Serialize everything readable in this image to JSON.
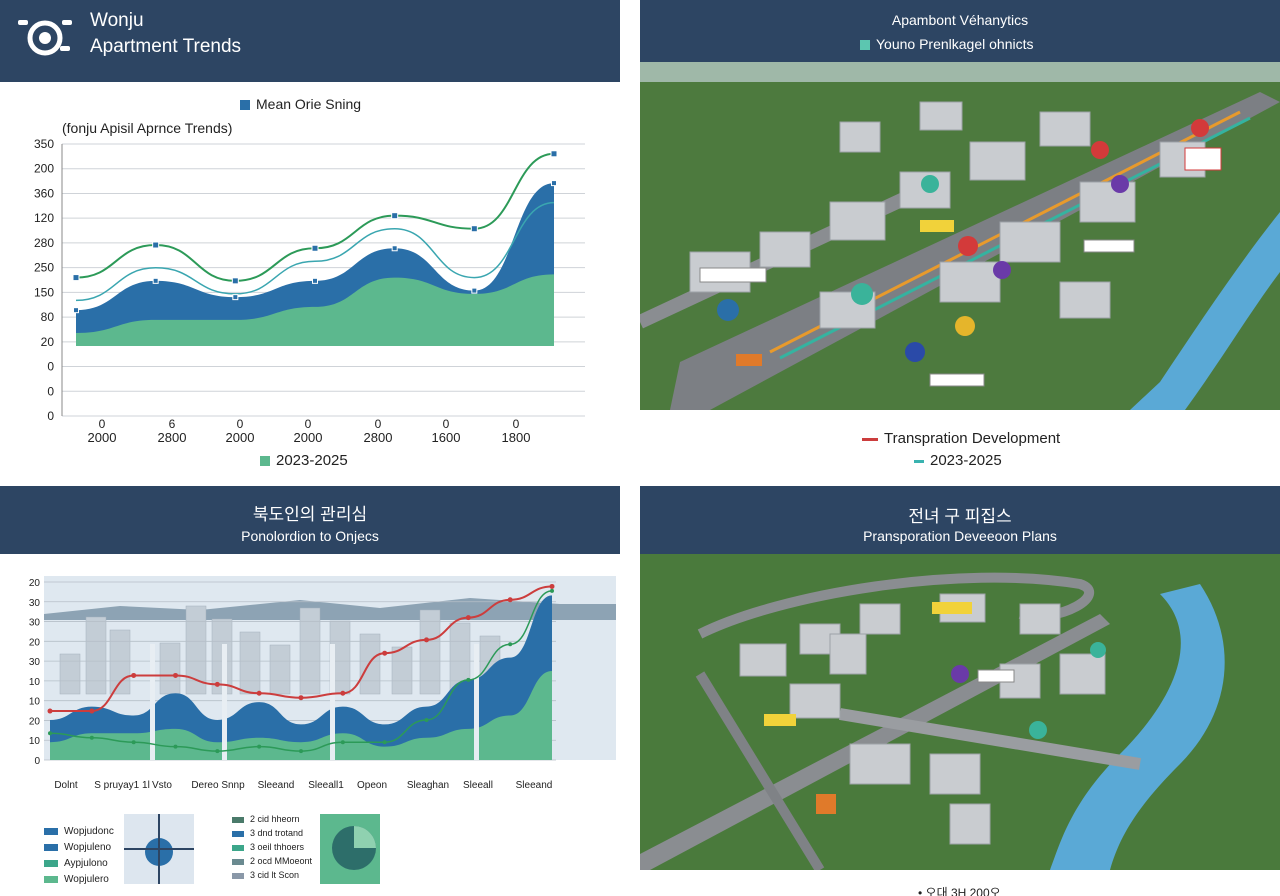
{
  "tl": {
    "title_line1": "Wonju",
    "title_line2": "Apartment Trends",
    "legend": "Mean Orie Sning",
    "subtitle": "(fonju Apisil Aprnce Trends)",
    "footer_legend": "2023-2025"
  },
  "tr": {
    "title": "Apambont Véhanytics",
    "legend": "Youno Prenlkagel ohnicts",
    "map_labels": [
      "Transpration Development",
      "2023-2025"
    ]
  },
  "bl": {
    "title_korean": "북도인의 관리심",
    "subtitle": "Ponolordion to Onjecs",
    "legend_a": [
      "Wopjudonc",
      "Wopjuleno",
      "Aypjulono",
      "Wopjulero"
    ],
    "legend_b": [
      "2 cid hheorn",
      "3 dnd trotand",
      "3 oeil thhoers",
      "2 ocd MMoeont",
      "3 cid lt Scon"
    ]
  },
  "br": {
    "title_korean": "전녀 구 피집스",
    "subtitle": "Pransporation Deveeoon Plans",
    "footer": "• 오대 3H 200오"
  },
  "colors": {
    "header": "#2d4563",
    "blue": "#2a6fa8",
    "teal": "#5cb88e",
    "green_line": "#2c9a58",
    "red_line": "#cc3d3d",
    "river": "#5aa9d6"
  },
  "chart_data": [
    {
      "type": "area",
      "title": "(fonju Apisil Aprnce Trends)",
      "legend": [
        "Mean Orie Sning",
        "2023-2025"
      ],
      "y_tick_labels": [
        "350",
        "200",
        "360",
        "120",
        "280",
        "250",
        "150",
        "80",
        "20",
        "0",
        "0",
        "0"
      ],
      "x_tick_labels_top": [
        "0",
        "6",
        "0",
        "0",
        "0",
        "0",
        "0"
      ],
      "x_tick_labels": [
        "2000",
        "2800",
        "2000",
        "2000",
        "2800",
        "1600",
        "1800"
      ],
      "series": [
        {
          "name": "Mean Orie Sning",
          "values": [
            1.1,
            2.0,
            1.5,
            2.0,
            3.0,
            1.7,
            5.0
          ]
        },
        {
          "name": "2023-2025",
          "values": [
            0.4,
            0.8,
            0.8,
            1.2,
            2.1,
            1.6,
            2.2
          ]
        },
        {
          "values": [
            2.1,
            3.1,
            2.0,
            3.0,
            4.0,
            3.6,
            5.9
          ]
        },
        {
          "values": [
            1.4,
            2.4,
            1.6,
            2.6,
            3.6,
            2.1,
            4.4
          ]
        }
      ]
    },
    {
      "type": "area",
      "y_tick_labels": [
        "20",
        "30",
        "30",
        "20",
        "30",
        "10",
        "10",
        "20",
        "10",
        "0"
      ],
      "x_tick_labels": [
        "Dolnt",
        "S pruyay1 1l",
        "Vsto",
        "Dereo Snnp",
        "Sleeand",
        "Sleeall1",
        "Opeon",
        "Sleaghan",
        "Sleeall",
        "Sleeand"
      ],
      "series": [
        {
          "values": [
            0.45,
            0.6,
            0.5,
            0.75,
            0.45,
            0.65,
            0.4,
            0.6,
            0.4,
            0.6,
            0.9,
            1.15,
            1.85
          ]
        },
        {
          "values": [
            0.2,
            0.3,
            0.3,
            0.35,
            0.2,
            0.25,
            0.2,
            0.3,
            0.15,
            0.25,
            0.35,
            0.5,
            1.0
          ]
        },
        {
          "values": [
            0.55,
            0.55,
            0.95,
            0.95,
            0.85,
            0.75,
            0.7,
            0.75,
            1.2,
            1.35,
            1.6,
            1.8,
            1.95
          ]
        },
        {
          "values": [
            0.3,
            0.25,
            0.2,
            0.15,
            0.1,
            0.15,
            0.1,
            0.2,
            0.2,
            0.45,
            0.9,
            1.3,
            1.9
          ]
        }
      ]
    }
  ]
}
